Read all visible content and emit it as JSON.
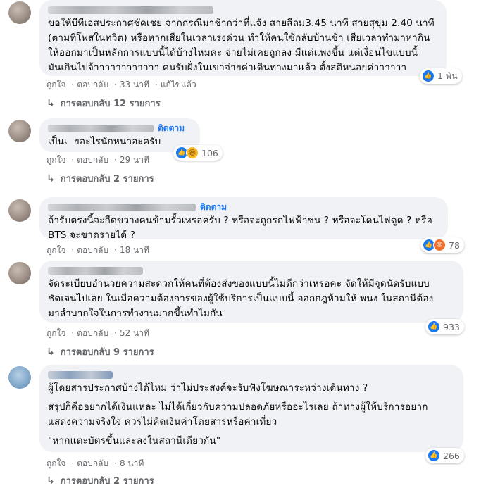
{
  "comments": [
    {
      "text": "ขอให้บีทีเอสประกาศชัดเชย จากกรณีมาช้ากว่าที่แจ้ง สายสีลม3.45 นาที สายสุขุม 2.40 นาที\n(ตามที่โพสในทวิต) หรือหากเสียในเวลาเร่งด่วน ทำให้คนใช้กลับบ้านช้า เสียเวลาทำมาหากิน\nให้ออกมาเป็นหลักการแบบนี้ได้บ้างไหมคะ จ่ายไม่เคยถูกลง มีแต่แพงขึ้น แต่เงื่อนไขแบบนี้\nมันเกินไปจ้าาาาาาาาาาาา คนรับฝั่งในเขาจ่ายค่าเดินทางมาแล้ว ตั้งสติหน่อยค่าาาาาา",
      "like": "ถูกใจ",
      "reply": "ตอบกลับ",
      "time": "33 นาที",
      "edited": "แก้ไขแล้ว",
      "reaction_count": "1 พัน",
      "replies": "การตอบกลับ 12 รายการ"
    },
    {
      "follow": "ติดตาม",
      "text": "เป็นเ  ยอะไรนักหนาอะครับ",
      "like": "ถูกใจ",
      "reply": "ตอบกลับ",
      "time": "29 นาที",
      "reaction_count": "106",
      "replies": "การตอบกลับ 2 รายการ"
    },
    {
      "follow": "ติดตาม",
      "text": "ถ้ารับตรงนี้จะกีดขวางคนข้ามรั้วเหรอครับ ? หรือจะถูกรถไฟฟ้าชน ? หรือจะโดนไฟดูด ? หรือ\nBTS จะขาดรายได้ ?",
      "like": "ถูกใจ",
      "reply": "ตอบกลับ",
      "time": "18 นาที",
      "reaction_count": "78"
    },
    {
      "text": "จัดระเบียบอำนวยความสะดวกให้คนที่ต้องส่งของแบบนี้ไม่ดีกว่าเหรอคะ จัดให้มีจุดนัดรับแบบ\nชัดเจนไปเลย ในเมื่อความต้องการของผู้ใช้บริการเป็นแบบนี้ ออกกฎห้ามให้ พนง ในสถานีต้อง\nมาลำบากใจในการทำงานมากขึ้นทำไมกัน",
      "like": "ถูกใจ",
      "reply": "ตอบกลับ",
      "time": "52 นาที",
      "reaction_count": "933",
      "replies": "การตอบกลับ 9 รายการ"
    },
    {
      "text1": "ผู้โดยสารประกาศบ้างได้ไหม ว่าไม่ประสงค์จะรับฟังโฆษณาระหว่างเดินทาง ?",
      "text2": "สรุปก็คืออยากได้เงินแหละ ไม่ได้เกี่ยวกับความปลอดภัยหรืออะไรเลย ถ้าทางผู้ให้บริการอยาก\nแสดงความจริงใจ ควรไม่คิดเงินค่าโดยสารหรือค่าเที่ยว",
      "text3": "\"หากแตะบัตรขึ้นและลงในสถานีเดียวกัน\"",
      "like": "ถูกใจ",
      "reply": "ตอบกลับ",
      "time": "8 นาที",
      "reaction_count": "266",
      "replies": "การตอบกลับ 2 รายการ"
    }
  ],
  "icons": {
    "reply_arrow": "reply-arrow-icon",
    "like": "like-reaction-icon",
    "haha": "haha-reaction-icon",
    "angry": "angry-reaction-icon"
  },
  "colors": {
    "bubble": "#f0f2f5",
    "link": "#1877f2",
    "meta": "#65676b"
  }
}
